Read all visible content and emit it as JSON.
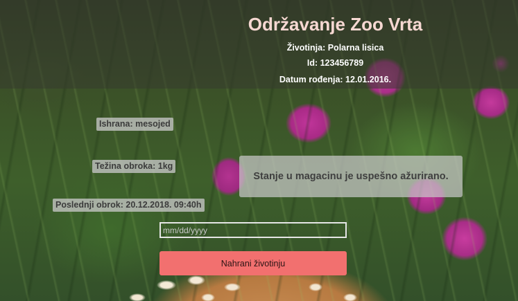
{
  "header": {
    "title": "Održavanje Zoo Vrta",
    "animal_line": "Životinja: Polarna lisica",
    "id_line": "Id: 123456789",
    "dob_line": "Datum rođenja: 12.01.2016."
  },
  "details": {
    "diet": "Ishrana: mesojed",
    "meal_weight": "Težina obroka: 1kg",
    "last_meal": "Poslednji obrok: 20.12.2018. 09:40h"
  },
  "notice": {
    "message": "Stanje u magacinu je uspešno ažurirano."
  },
  "form": {
    "date_placeholder": "mm/dd/yyyy",
    "date_value": "",
    "feed_button_label": "Nahrani životinju"
  },
  "colors": {
    "title": "#f6d8d2",
    "button": "#f2706f",
    "label_bg": "#c6c6c6"
  }
}
